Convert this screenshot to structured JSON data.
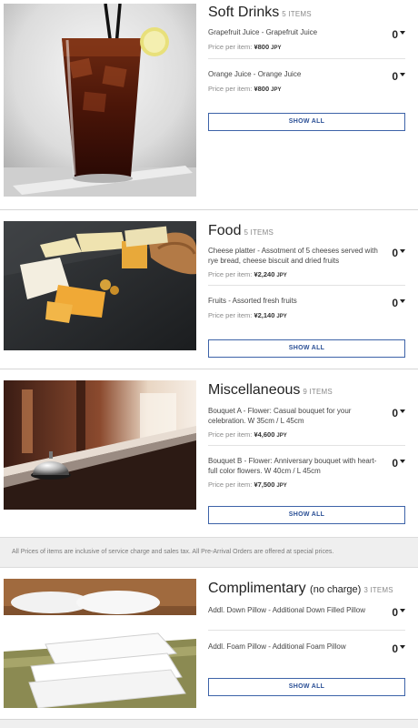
{
  "notice": "All Prices of items are inclusive of service charge and sales tax. All Pre-Arrival Orders are offered at special prices.",
  "sections": [
    {
      "title": "Soft Drinks",
      "subtitle": "",
      "count": "5 ITEMS",
      "show_all": "SHOW ALL",
      "items": [
        {
          "name": "Grapefruit Juice - Grapefruit Juice",
          "price_label": "Price per item:",
          "price": "¥800",
          "currency": "JPY",
          "qty": "0"
        },
        {
          "name": "Orange Juice - Orange Juice",
          "price_label": "Price per item:",
          "price": "¥800",
          "currency": "JPY",
          "qty": "0"
        }
      ]
    },
    {
      "title": "Food",
      "subtitle": "",
      "count": "5 ITEMS",
      "show_all": "SHOW ALL",
      "items": [
        {
          "name": "Cheese platter - Assotment of 5 cheeses served with rye bread, cheese biscuit and dried fruits",
          "price_label": "Price per item:",
          "price": "¥2,240",
          "currency": "JPY",
          "qty": "0"
        },
        {
          "name": "Fruits - Assorted fresh fruits",
          "price_label": "Price per item:",
          "price": "¥2,140",
          "currency": "JPY",
          "qty": "0"
        }
      ]
    },
    {
      "title": "Miscellaneous",
      "subtitle": "",
      "count": "9 ITEMS",
      "show_all": "SHOW ALL",
      "items": [
        {
          "name": "Bouquet A - Flower: Casual bouquet for your celebration. W 35cm / L 45cm",
          "price_label": "Price per item:",
          "price": "¥4,600",
          "currency": "JPY",
          "qty": "0"
        },
        {
          "name": "Bouquet B - Flower: Anniversary bouquet with heart-full color flowers. W 40cm / L 45cm",
          "price_label": "Price per item:",
          "price": "¥7,500",
          "currency": "JPY",
          "qty": "0"
        }
      ]
    },
    {
      "title": "Complimentary",
      "subtitle": "(no charge)",
      "count": "3 ITEMS",
      "show_all": "SHOW ALL",
      "items": [
        {
          "name": "Addl. Down Pillow - Additional Down Filled Pillow",
          "price_label": "",
          "price": "",
          "currency": "",
          "qty": "0"
        },
        {
          "name": "Addl. Foam Pillow - Additional Foam Pillow",
          "price_label": "",
          "price": "",
          "currency": "",
          "qty": "0"
        }
      ]
    }
  ]
}
